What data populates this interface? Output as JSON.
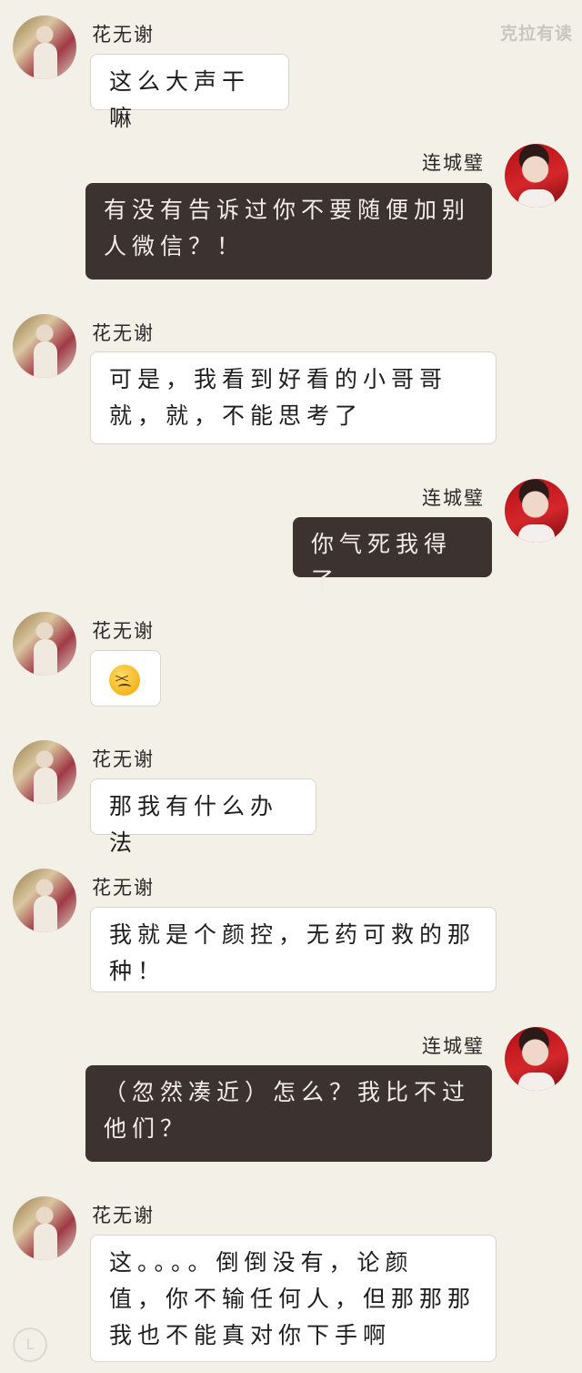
{
  "watermark": "克拉有读",
  "messages": [
    {
      "side": "left",
      "sender": "花无谢",
      "lines": [
        "这么大声干嘛"
      ]
    },
    {
      "side": "right",
      "sender": "连城璧",
      "lines": [
        "有没有告诉过你不要随便加别",
        "人微信？！"
      ]
    },
    {
      "side": "left",
      "sender": "花无谢",
      "lines": [
        "可是，我看到好看的小哥哥",
        "就，就，不能思考了"
      ]
    },
    {
      "side": "right",
      "sender": "连城璧",
      "lines": [
        "你气死我得了"
      ]
    },
    {
      "side": "left",
      "sender": "花无谢",
      "emoji": "persevering-face"
    },
    {
      "side": "left",
      "sender": "花无谢",
      "lines": [
        "那我有什么办法"
      ]
    },
    {
      "side": "left",
      "sender": "花无谢",
      "lines": [
        "我就是个颜控，无药可救的那",
        "种！"
      ]
    },
    {
      "side": "right",
      "sender": "连城璧",
      "lines": [
        "（忽然凑近）怎么？我比不过",
        "他们？"
      ]
    },
    {
      "side": "left",
      "sender": "花无谢",
      "lines": [
        "这。。。。倒倒没有，论颜",
        "值，你不输任何人，但那那那",
        "我也不能真对你下手啊"
      ]
    }
  ]
}
